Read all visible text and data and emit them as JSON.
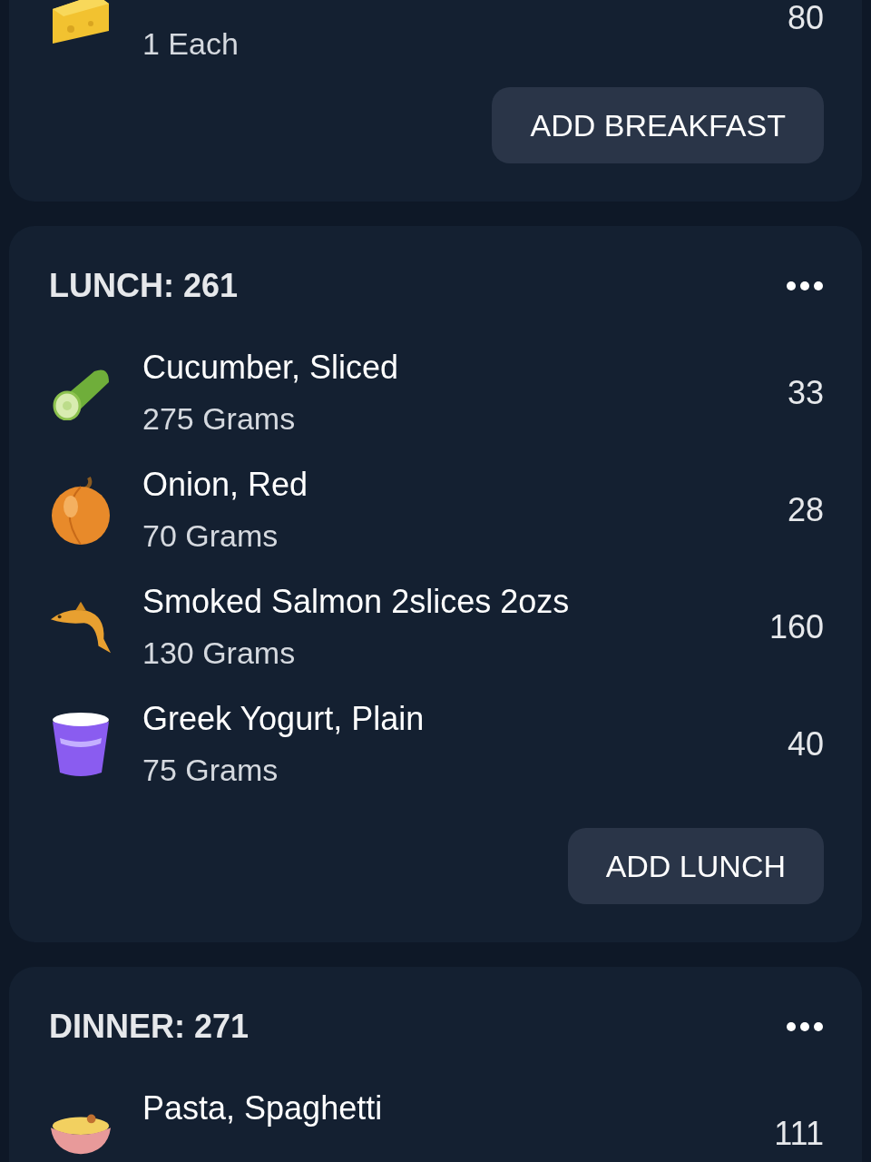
{
  "meals": [
    {
      "items": [
        {
          "kind": "cheese",
          "amount": "1 Each",
          "calories": "80"
        }
      ],
      "button": "ADD BREAKFAST"
    },
    {
      "title": "LUNCH: 261",
      "items": [
        {
          "kind": "cucumber",
          "name": "Cucumber, Sliced",
          "amount": "275 Grams",
          "calories": "33"
        },
        {
          "kind": "onion",
          "name": "Onion, Red",
          "amount": "70 Grams",
          "calories": "28"
        },
        {
          "kind": "fish",
          "name": "Smoked Salmon 2slices 2ozs",
          "amount": "130 Grams",
          "calories": "160"
        },
        {
          "kind": "yogurt",
          "name": "Greek Yogurt, Plain",
          "amount": "75 Grams",
          "calories": "40"
        }
      ],
      "button": "ADD LUNCH"
    },
    {
      "title": "DINNER: 271",
      "items": [
        {
          "kind": "pasta",
          "name": "Pasta, Spaghetti",
          "calories": "111"
        }
      ]
    }
  ]
}
